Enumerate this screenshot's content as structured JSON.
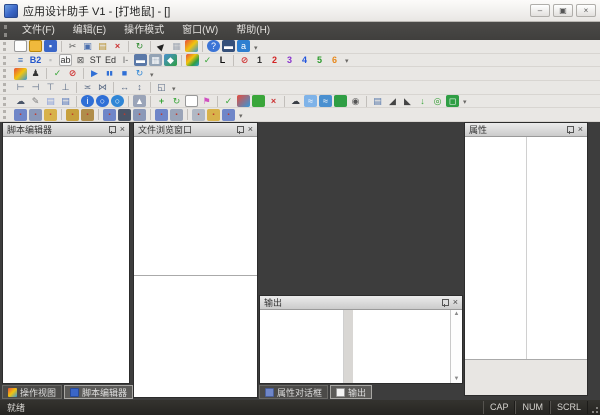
{
  "window": {
    "title": "应用设计助手 V1 - [打地鼠] - []",
    "controls": {
      "minimize": "–",
      "maximize": "▣",
      "close": "×"
    }
  },
  "icons": {
    "chevron": "▾",
    "scroll_up": "▲",
    "scroll_down": "▼",
    "panel_close": "×"
  },
  "menu": {
    "items": [
      {
        "label": "文件(F)"
      },
      {
        "label": "编辑(E)"
      },
      {
        "label": "操作模式"
      },
      {
        "label": "窗口(W)"
      },
      {
        "label": "帮助(H)"
      }
    ]
  },
  "toolbars": [
    {
      "name": "standard-toolbar",
      "items": [
        {
          "name": "new-file-icon",
          "glyph": "",
          "bg": "#fdfdfd",
          "border": "#9a9a9a"
        },
        {
          "name": "open-folder-icon",
          "glyph": "",
          "bg": "#f0b93c",
          "border": "#b8860b"
        },
        {
          "name": "save-icon",
          "glyph": "▪",
          "fg": "#ffffff",
          "bg": "#3a66c8"
        },
        {
          "sep": true
        },
        {
          "name": "cut-icon",
          "glyph": "✂",
          "fg": "#555555"
        },
        {
          "name": "copy-icon",
          "glyph": "▣",
          "fg": "#4a6fae"
        },
        {
          "name": "paste-icon",
          "glyph": "▤",
          "fg": "#b8902f"
        },
        {
          "name": "delete-icon",
          "glyph": "×",
          "fg": "#cc3333",
          "bold": true
        },
        {
          "sep": true
        },
        {
          "name": "export-run-icon",
          "glyph": "↻",
          "fg": "#2e8b2e"
        },
        {
          "sep": true
        },
        {
          "name": "cursor-tool-icon",
          "glyph": "▶",
          "fg": "#222222",
          "rot": -45
        },
        {
          "name": "grid-toggle-icon",
          "glyph": "▦",
          "fg": "#a0a8b4"
        },
        {
          "name": "palette-icon",
          "glyph": "",
          "bg": "linear-gradient(135deg,#e74c3c 0%,#f1c40f 50%,#3498db 100%)"
        },
        {
          "sep": true
        },
        {
          "name": "help-icon",
          "glyph": "?",
          "fg": "#ffffff",
          "bg": "#3b74d6",
          "round": true
        },
        {
          "name": "device-icon",
          "glyph": "▬",
          "fg": "#ffffff",
          "bg": "#35507a"
        },
        {
          "name": "language-icon",
          "glyph": "a",
          "fg": "#ffffff",
          "bg": "#2e7fd0"
        }
      ]
    },
    {
      "name": "controls-toolbar",
      "items": [
        {
          "name": "report-view-icon",
          "glyph": "≡",
          "fg": "#3b6db5"
        },
        {
          "name": "button-control-icon",
          "glyph": "B2",
          "fg": "#2255cc",
          "bold": true
        },
        {
          "name": "dim-control-icon",
          "glyph": "▪",
          "fg": "#c0c0c0"
        },
        {
          "name": "editbox-control-icon",
          "glyph": "ab",
          "fg": "#333333",
          "bg": "#f7f7f7",
          "border": "#aaaaaa"
        },
        {
          "name": "checkbox-control-icon",
          "glyph": "⊠",
          "fg": "#555555"
        },
        {
          "name": "static-control-icon",
          "glyph": "ST",
          "fg": "#333333"
        },
        {
          "name": "edit-control-icon",
          "glyph": "Ed",
          "fg": "#333333"
        },
        {
          "name": "line-control-icon",
          "glyph": "I-",
          "fg": "#666666"
        },
        {
          "name": "monitor-control-icon",
          "glyph": "▬",
          "fg": "#ffffff",
          "bg": "#5b79a8"
        },
        {
          "name": "keyboard-control-icon",
          "glyph": "▦",
          "fg": "#ffffff",
          "bg": "#93a3b5"
        },
        {
          "name": "window-control-icon",
          "glyph": "◆",
          "fg": "#ffffff",
          "bg": "linear-gradient(135deg,#4a90d0,#2f9e44)"
        },
        {
          "sep": true
        },
        {
          "name": "grid-colors-icon",
          "glyph": "",
          "bg": "linear-gradient(135deg,#e74c3c 0%,#f1c40f 40%,#2f9e44 70%,#3498db 100%)"
        },
        {
          "name": "apply-check-icon",
          "glyph": "✓",
          "fg": "#3aa63a",
          "bold": true
        },
        {
          "name": "label-l-icon",
          "glyph": "L",
          "fg": "#111111",
          "bold": true
        },
        {
          "sep": true
        },
        {
          "name": "no-entry-icon",
          "glyph": "⊘",
          "fg": "#d03a3a",
          "bold": true
        },
        {
          "name": "layer-1-icon",
          "glyph": "1",
          "fg": "#333333",
          "bold": true
        },
        {
          "name": "layer-2-icon",
          "glyph": "2",
          "fg": "#d22222",
          "bold": true
        },
        {
          "name": "layer-3-icon",
          "glyph": "3",
          "fg": "#8833cc",
          "bold": true
        },
        {
          "name": "layer-4-icon",
          "glyph": "4",
          "fg": "#2255dd",
          "bold": true
        },
        {
          "name": "layer-5-icon",
          "glyph": "5",
          "fg": "#2a9a2a",
          "bold": true
        },
        {
          "name": "layer-6-icon",
          "glyph": "6",
          "fg": "#e8881a",
          "bold": true
        }
      ]
    },
    {
      "name": "run-toolbar",
      "items": [
        {
          "name": "scene-grid-icon",
          "glyph": "",
          "bg": "linear-gradient(135deg,#e74c3c 0%,#f1c40f 50%,#3498db 100%)"
        },
        {
          "name": "actor-icon",
          "glyph": "♟",
          "fg": "#333333"
        },
        {
          "sep": true
        },
        {
          "name": "run-check-icon",
          "glyph": "✓",
          "fg": "#3aa63a",
          "bold": true
        },
        {
          "name": "stop-forbid-icon",
          "glyph": "⊘",
          "fg": "#d03a3a",
          "bold": true
        },
        {
          "sep": true
        },
        {
          "name": "play-icon",
          "glyph": "▶",
          "fg": "#2f6fd6"
        },
        {
          "name": "pause-icon",
          "glyph": "▮▮",
          "fg": "#2f6fd6",
          "small": true
        },
        {
          "name": "stop-icon",
          "glyph": "■",
          "fg": "#2f6fd6"
        },
        {
          "name": "loop-icon",
          "glyph": "↻",
          "fg": "#2f86d6"
        }
      ]
    },
    {
      "name": "align-toolbar",
      "items": [
        {
          "name": "align-left-icon",
          "glyph": "⊢",
          "fg": "#5a6b85"
        },
        {
          "name": "align-right-icon",
          "glyph": "⊣",
          "fg": "#5a6b85"
        },
        {
          "name": "align-top-icon",
          "glyph": "⊤",
          "fg": "#5a6b85"
        },
        {
          "name": "align-bottom-icon",
          "glyph": "⊥",
          "fg": "#5a6b85"
        },
        {
          "sep": true
        },
        {
          "name": "center-horizontal-icon",
          "glyph": "≍",
          "fg": "#5a6b85"
        },
        {
          "name": "center-vertical-icon",
          "glyph": "⋈",
          "fg": "#5a6b85"
        },
        {
          "sep": true
        },
        {
          "name": "same-width-icon",
          "glyph": "↔",
          "fg": "#5a6b85"
        },
        {
          "name": "same-height-icon",
          "glyph": "↕",
          "fg": "#5a6b85"
        },
        {
          "sep": true
        },
        {
          "name": "same-size-icon",
          "glyph": "◱",
          "fg": "#5a6b85"
        }
      ]
    },
    {
      "name": "tools-toolbar",
      "items": [
        {
          "name": "paint-icon",
          "glyph": "☁",
          "fg": "#4a5568"
        },
        {
          "name": "pencil-icon",
          "glyph": "✎",
          "fg": "#7a7a7a"
        },
        {
          "name": "layers-light-icon",
          "glyph": "▤",
          "fg": "#8aa0d8"
        },
        {
          "name": "layers-dark-icon",
          "glyph": "▤",
          "fg": "#5577bb"
        },
        {
          "sep": true
        },
        {
          "name": "info-icon",
          "glyph": "i",
          "fg": "#ffffff",
          "bg": "#2f6fd6",
          "round": true
        },
        {
          "name": "circle-tool-icon",
          "glyph": "○",
          "fg": "#ffffff",
          "bg": "#2f6fd6",
          "round": true
        },
        {
          "name": "circle-tool2-icon",
          "glyph": "○",
          "fg": "#ffffff",
          "bg": "#2f86d6",
          "round": true
        },
        {
          "sep": true
        },
        {
          "name": "lamp-icon",
          "glyph": "▲",
          "fg": "#ffffff",
          "bg": "#9aa4b8"
        },
        {
          "sep": true
        },
        {
          "name": "move-icon",
          "glyph": "+",
          "fg": "#3aa63a",
          "bold": true
        },
        {
          "name": "refresh-icon",
          "glyph": "↻",
          "fg": "#3aa63a"
        },
        {
          "name": "blank-page-icon",
          "glyph": "",
          "bg": "#ffffff",
          "border": "#999999"
        },
        {
          "name": "flag-icon",
          "glyph": "⚑",
          "fg": "#d050c0"
        },
        {
          "sep": true
        },
        {
          "name": "validate-icon",
          "glyph": "✓",
          "fg": "#3aa63a",
          "bold": true
        },
        {
          "name": "blocks-icon",
          "glyph": "",
          "bg": "linear-gradient(135deg,#e74c3c,#3498db)"
        },
        {
          "name": "green-block-icon",
          "glyph": "",
          "bg": "#3aa63a"
        },
        {
          "name": "remove-icon",
          "glyph": "×",
          "fg": "#cc3333",
          "bold": true
        },
        {
          "sep": true
        },
        {
          "name": "cloud-dark-icon",
          "glyph": "☁",
          "fg": "#3a3f46"
        },
        {
          "name": "wave-light-icon",
          "glyph": "≈",
          "fg": "#ffffff",
          "bg": "#7fb3e8"
        },
        {
          "name": "wave-dark-icon",
          "glyph": "≈",
          "fg": "#ffffff",
          "bg": "#4a90d0"
        },
        {
          "name": "terrain-icon",
          "glyph": "",
          "bg": "#2f9e44"
        },
        {
          "name": "bug-icon",
          "glyph": "◉",
          "fg": "#555555"
        },
        {
          "sep": true
        },
        {
          "name": "stack-icon",
          "glyph": "▤",
          "fg": "#5577aa"
        },
        {
          "name": "bird-left-icon",
          "glyph": "◢",
          "fg": "#444444"
        },
        {
          "name": "bird-right-icon",
          "glyph": "◣",
          "fg": "#444444"
        },
        {
          "name": "drop-icon",
          "glyph": "↓",
          "fg": "#3aa63a"
        },
        {
          "name": "target-icon",
          "glyph": "◎",
          "fg": "#2a9a2a",
          "bold": true
        },
        {
          "name": "target-square-icon",
          "glyph": "◻",
          "fg": "#ffffff",
          "bg": "#2f9e44"
        }
      ]
    },
    {
      "name": "assets-toolbar",
      "items": [
        {
          "name": "asset-folder-icon",
          "glyph": "▪",
          "fg": "#c0392b",
          "bg": "#6f86c8",
          "small": true
        },
        {
          "name": "asset-folder-icon",
          "glyph": "▪",
          "fg": "#c0392b",
          "bg": "#8a98b8",
          "small": true
        },
        {
          "name": "asset-folder-icon",
          "glyph": "▪",
          "fg": "#c0392b",
          "bg": "#d8b24a",
          "small": true
        },
        {
          "sep": true
        },
        {
          "name": "asset-folder-icon",
          "glyph": "▪",
          "fg": "#c0392b",
          "bg": "#c7a03c",
          "small": true
        },
        {
          "name": "asset-folder-icon",
          "glyph": "▪",
          "fg": "#c0392b",
          "bg": "#b08d4a",
          "small": true
        },
        {
          "sep": true
        },
        {
          "name": "asset-folder-icon",
          "glyph": "▪",
          "fg": "#c0392b",
          "bg": "#6f86c8",
          "small": true
        },
        {
          "name": "asset-folder-icon",
          "glyph": "▪",
          "fg": "#c0392b",
          "bg": "#4a5568",
          "small": true
        },
        {
          "name": "asset-folder-icon",
          "glyph": "▪",
          "fg": "#c0392b",
          "bg": "#8a98b8",
          "small": true
        },
        {
          "sep": true
        },
        {
          "name": "asset-folder-icon",
          "glyph": "▪",
          "fg": "#c0392b",
          "bg": "#6f86c8",
          "small": true
        },
        {
          "name": "asset-folder-icon",
          "glyph": "▪",
          "fg": "#c0392b",
          "bg": "#9aa4b8",
          "small": true
        },
        {
          "sep": true
        },
        {
          "name": "asset-folder-icon",
          "glyph": "▪",
          "fg": "#c0392b",
          "bg": "#b0b8c4",
          "small": true
        },
        {
          "name": "asset-folder-icon",
          "glyph": "▪",
          "fg": "#c0392b",
          "bg": "#d8b24a",
          "small": true
        },
        {
          "name": "asset-folder-icon",
          "glyph": "▪",
          "fg": "#c0392b",
          "bg": "#6f86c8",
          "small": true
        }
      ]
    }
  ],
  "panels": {
    "script_editor": {
      "title": "脚本编辑器"
    },
    "file_browser": {
      "title": "文件浏览窗口"
    },
    "properties": {
      "title": "属性"
    },
    "output": {
      "title": "输出"
    }
  },
  "bottom_tabs_left": [
    {
      "label": "操作视图"
    },
    {
      "label": "脚本编辑器"
    }
  ],
  "bottom_tabs_middle": [
    {
      "label": "属性对话框"
    },
    {
      "label": "输出"
    }
  ],
  "statusbar": {
    "ready": "就绪",
    "indicators": [
      "CAP",
      "NUM",
      "SCRL"
    ]
  }
}
